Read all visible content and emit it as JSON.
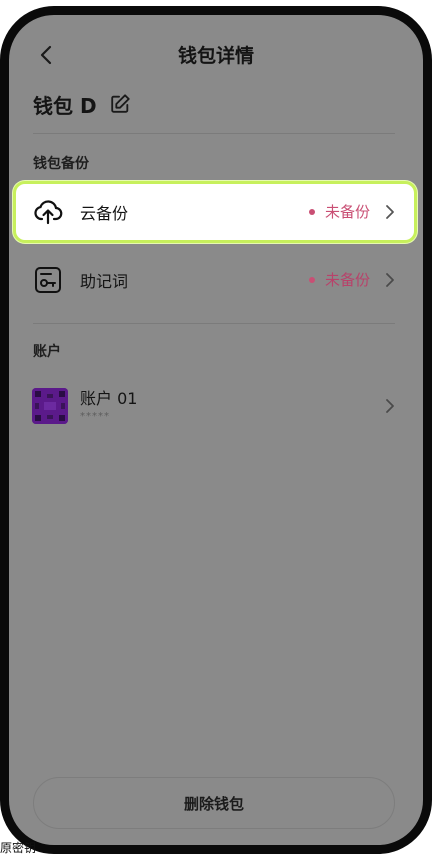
{
  "nav": {
    "title": "钱包详情"
  },
  "wallet": {
    "name": "钱包 D"
  },
  "backup_section": {
    "label": "钱包备份",
    "items": [
      {
        "label": "云备份",
        "status": "未备份"
      },
      {
        "label": "助记词",
        "status": "未备份"
      }
    ]
  },
  "accounts_section": {
    "label": "账户",
    "items": [
      {
        "name": "账户 01",
        "masked": "*****"
      }
    ]
  },
  "actions": {
    "delete_label": "删除钱包"
  },
  "caption": {
    "text": "原密钥"
  },
  "colors": {
    "highlight_border": "#c7f05c",
    "status_text": "#c94f74",
    "screen_overlay": "#8a8a8a"
  }
}
